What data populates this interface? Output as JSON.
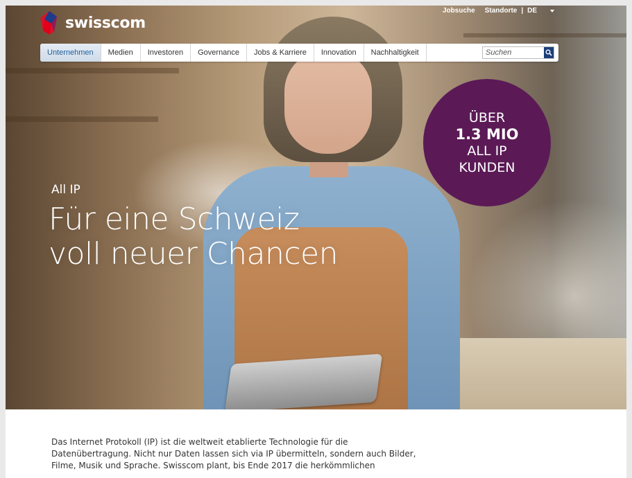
{
  "brand": {
    "name": "swisscom"
  },
  "utility_nav": {
    "jobs": "Jobsuche",
    "locations": "Standorte",
    "separator": "|",
    "language": "DE"
  },
  "main_nav": {
    "items": [
      {
        "label": "Unternehmen",
        "active": true
      },
      {
        "label": "Medien"
      },
      {
        "label": "Investoren"
      },
      {
        "label": "Governance"
      },
      {
        "label": "Jobs & Karriere"
      },
      {
        "label": "Innovation"
      },
      {
        "label": "Nachhaltigkeit"
      }
    ],
    "search": {
      "placeholder": "Suchen",
      "value": ""
    }
  },
  "hero": {
    "kicker": "All IP",
    "headline_line1": "Für eine Schweiz",
    "headline_line2": "voll neuer Chancen",
    "badge": {
      "line1": "ÜBER",
      "line2": "1.3 MIO",
      "line3": "ALL IP",
      "line4": "KUNDEN",
      "color": "#5b1a56"
    }
  },
  "intro": {
    "line1": "Das Internet Protokoll (IP) ist die weltweit etablierte Technologie für die",
    "line2": "Datenübertragung. Nicht nur Daten lassen sich via IP übermitteln, sondern auch Bilder,",
    "line3": "Filme, Musik und Sprache. Swisscom plant, bis Ende 2017 die herkömmlichen"
  },
  "colors": {
    "nav_active_text": "#1f5e9a",
    "search_button": "#1c3f7c"
  }
}
